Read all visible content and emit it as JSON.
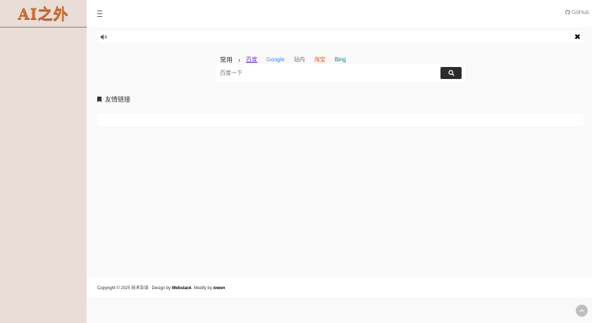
{
  "sidebar": {
    "logo_text": "AI之外"
  },
  "header": {
    "github_label": "GitHub"
  },
  "search": {
    "group_label": "常用",
    "arrow": "›",
    "tabs": [
      {
        "label": "百度"
      },
      {
        "label": "Google"
      },
      {
        "label": "站内"
      },
      {
        "label": "淘宝"
      },
      {
        "label": "Bing"
      }
    ],
    "placeholder": "百度一下"
  },
  "friends": {
    "title": "友情链接"
  },
  "footer": {
    "copyright": "Copyright © 2025 技术杂谈",
    "design_prefix": "Design by",
    "design_name": "Webstack",
    "modify_prefix": "Modify by",
    "modify_name": "iowen"
  },
  "colors": {
    "logo": "#d26d35",
    "sidebar_bg": "#e8ddd7",
    "search_button": "#2c2c2c"
  }
}
